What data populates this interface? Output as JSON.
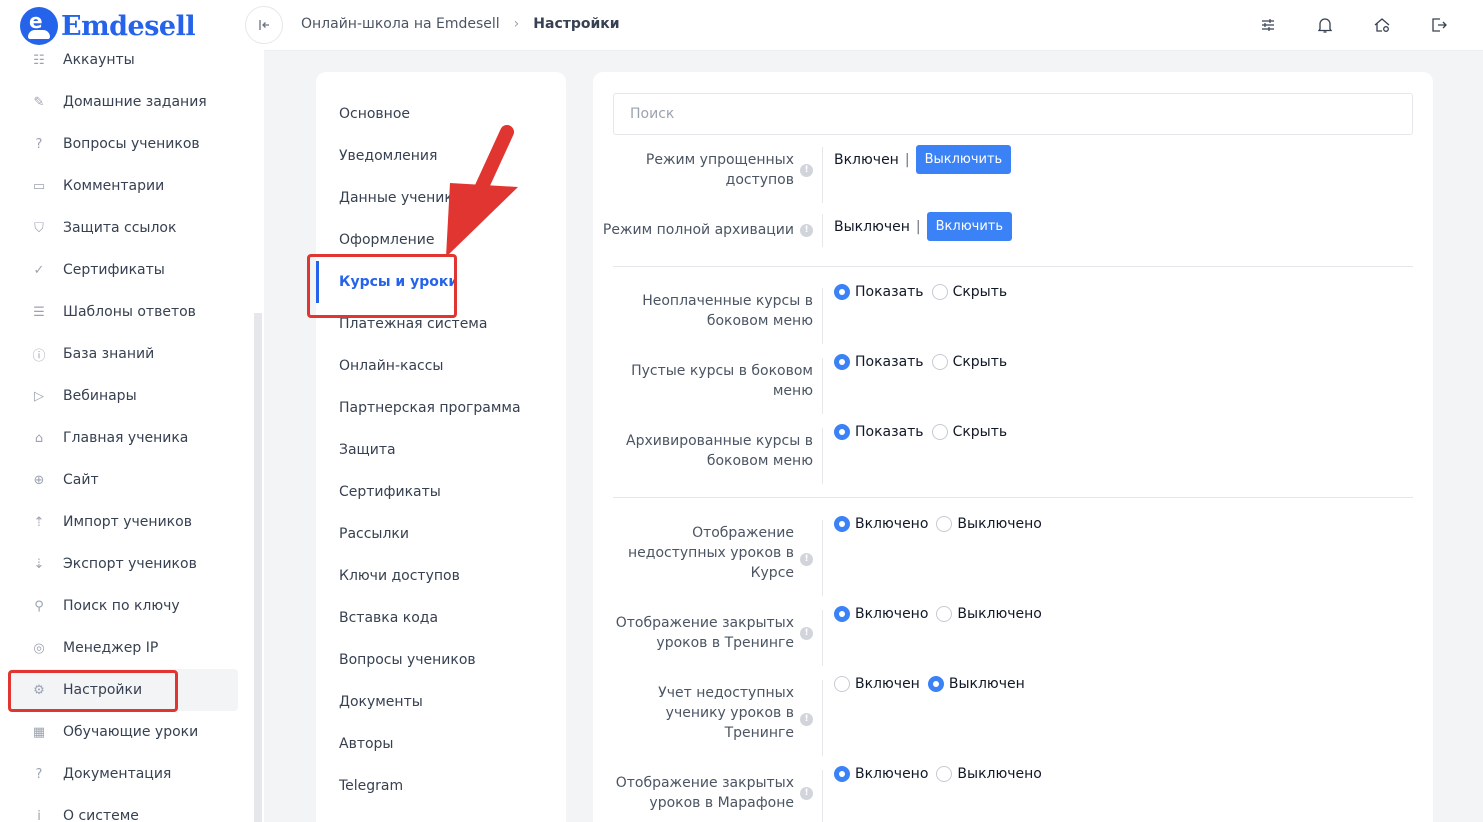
{
  "brand": {
    "name": "Emdesell",
    "color": "#2563eb"
  },
  "sidebar": {
    "items": [
      {
        "label": "Аккаунты",
        "icon": "users-icon"
      },
      {
        "label": "Домашние задания",
        "icon": "pencil-icon"
      },
      {
        "label": "Вопросы учеников",
        "icon": "question-circle-icon"
      },
      {
        "label": "Комментарии",
        "icon": "comment-icon"
      },
      {
        "label": "Защита ссылок",
        "icon": "shield-icon"
      },
      {
        "label": "Сертификаты",
        "icon": "badge-check-icon"
      },
      {
        "label": "Шаблоны ответов",
        "icon": "list-icon"
      },
      {
        "label": "База знаний",
        "icon": "info-circle-icon"
      },
      {
        "label": "Вебинары",
        "icon": "play-icon"
      },
      {
        "label": "Главная ученика",
        "icon": "home-gear-icon"
      },
      {
        "label": "Сайт",
        "icon": "globe-icon"
      },
      {
        "label": "Импорт учеников",
        "icon": "upload-icon"
      },
      {
        "label": "Экспорт учеников",
        "icon": "download-icon"
      },
      {
        "label": "Поиск по ключу",
        "icon": "search-icon"
      },
      {
        "label": "Менеджер IP",
        "icon": "target-icon"
      },
      {
        "label": "Настройки",
        "icon": "gear-icon",
        "active": true
      },
      {
        "label": "Обучающие уроки",
        "icon": "film-icon"
      },
      {
        "label": "Документация",
        "icon": "help-box-icon"
      },
      {
        "label": "О системе",
        "icon": "info-box-icon"
      }
    ]
  },
  "header": {
    "breadcrumb": [
      "Онлайн-школа на Emdesell",
      "Настройки"
    ],
    "icons": [
      "sliders-icon",
      "bell-icon",
      "home-settings-icon",
      "logout-icon"
    ]
  },
  "settings_nav": {
    "items": [
      "Основное",
      "Уведомления",
      "Данные учеников",
      "Оформление",
      "Курсы и уроки",
      "Платежная система",
      "Онлайн-кассы",
      "Партнерская программа",
      "Защита",
      "Сертификаты",
      "Рассылки",
      "Ключи доступов",
      "Вставка кода",
      "Вопросы учеников",
      "Документы",
      "Авторы",
      "Telegram"
    ],
    "active": "Курсы и уроки"
  },
  "content": {
    "search_placeholder": "Поиск",
    "rows": [
      {
        "label_lines": [
          "Режим упрощенных",
          "доступов"
        ],
        "status": "Включен",
        "button": "Выключить",
        "info": true
      },
      {
        "label_lines": [
          "Режим полной архивации"
        ],
        "status": "Выключен",
        "button": "Включить",
        "info": true
      },
      {
        "label_lines": [
          "Неоплаченные курсы в",
          "боковом меню"
        ],
        "options": [
          "Показать",
          "Скрыть"
        ],
        "selected": "Показать"
      },
      {
        "label_lines": [
          "Пустые курсы в боковом",
          "меню"
        ],
        "options": [
          "Показать",
          "Скрыть"
        ],
        "selected": "Показать"
      },
      {
        "label_lines": [
          "Архивированные курсы в",
          "боковом меню"
        ],
        "options": [
          "Показать",
          "Скрыть"
        ],
        "selected": "Показать"
      },
      {
        "label_lines": [
          "Отображение",
          "недоступных уроков в",
          "Курсе"
        ],
        "options": [
          "Включено",
          "Выключено"
        ],
        "selected": "Включено",
        "info": true
      },
      {
        "label_lines": [
          "Отображение закрытых",
          "уроков в Тренинге"
        ],
        "options": [
          "Включено",
          "Выключено"
        ],
        "selected": "Включено",
        "info": true
      },
      {
        "label_lines": [
          "Учет недоступных",
          "ученику уроков в",
          "Тренинге"
        ],
        "options": [
          "Включен",
          "Выключен"
        ],
        "selected": "Выключен",
        "info": true
      },
      {
        "label_lines": [
          "Отображение закрытых",
          "уроков в Марафоне"
        ],
        "options": [
          "Включено",
          "Выключено"
        ],
        "selected": "Включено",
        "info": true
      }
    ]
  },
  "colors": {
    "accent": "#3b82f6",
    "annotation": "#e03530"
  }
}
